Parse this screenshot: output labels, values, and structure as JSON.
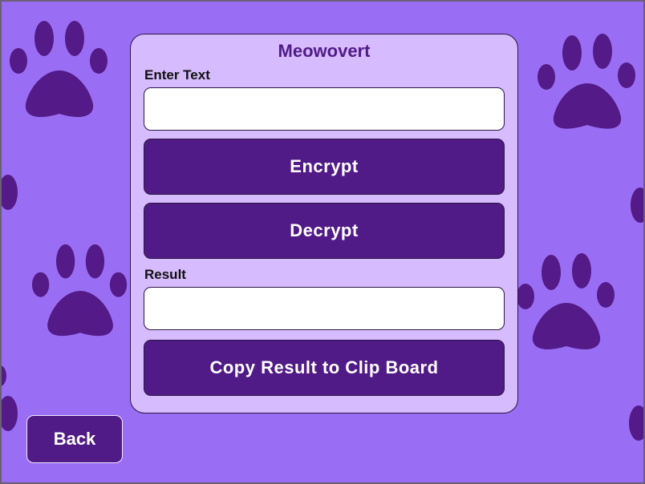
{
  "app": {
    "title": "Meowovert"
  },
  "colors": {
    "background": "#9a6ef4",
    "panel": "#d6bbfe",
    "accent": "#511b87",
    "paw": "#531a88"
  },
  "background_icon": "paw-print-icon",
  "form": {
    "input_label": "Enter Text",
    "input_value": "",
    "encrypt_label": "Encrypt",
    "decrypt_label": "Decrypt",
    "result_label": "Result",
    "result_value": "",
    "copy_label": "Copy Result to Clip Board"
  },
  "nav": {
    "back_label": "Back"
  }
}
